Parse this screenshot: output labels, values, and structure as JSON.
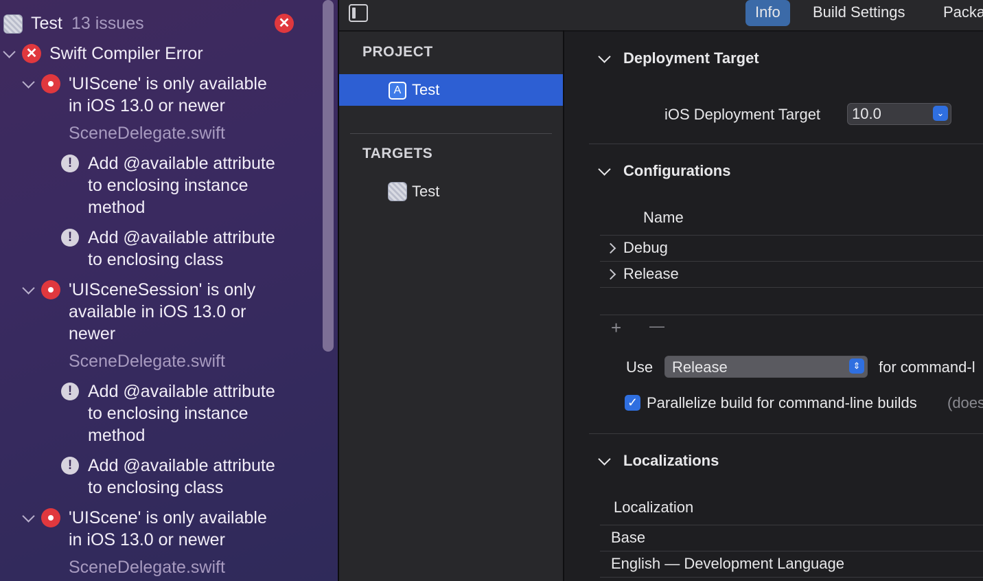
{
  "issues": {
    "header_title": "Test",
    "header_count": "13 issues",
    "group_title": "Swift Compiler Error",
    "items": [
      {
        "line1": "'UIScene' is only available",
        "line2": "in iOS 13.0 or newer",
        "file": "SceneDelegate.swift"
      },
      {
        "line1": "'UISceneSession' is only",
        "line2": "available in iOS 13.0 or",
        "line3": "newer",
        "file": "SceneDelegate.swift"
      },
      {
        "line1": "'UIScene' is only available",
        "line2": "in iOS 13.0 or newer",
        "file": "SceneDelegate.swift"
      }
    ],
    "fixits": [
      {
        "line1": "Add @available attribute",
        "line2": "to enclosing instance",
        "line3": "method"
      },
      {
        "line1": "Add @available attribute",
        "line2": "to enclosing class"
      },
      {
        "line1": "Add @available attribute",
        "line2": "to enclosing instance",
        "line3": "method"
      },
      {
        "line1": "Add @available attribute",
        "line2": "to enclosing class"
      }
    ]
  },
  "project_nav": {
    "project_header": "PROJECT",
    "project_item": "Test",
    "targets_header": "TARGETS",
    "target_item": "Test"
  },
  "tabs": {
    "info": "Info",
    "build_settings": "Build Settings",
    "packages": "Packa"
  },
  "deployment": {
    "title": "Deployment Target",
    "ios_label": "iOS Deployment Target",
    "ios_value": "10.0"
  },
  "configurations": {
    "title": "Configurations",
    "column_name": "Name",
    "rows": [
      "Debug",
      "Release"
    ],
    "add": "+",
    "remove": "—",
    "use_label": "Use",
    "use_value": "Release",
    "for_label": "for command-l",
    "parallelize_label": "Parallelize build for command-line builds",
    "parallelize_note": "(does",
    "parallelize_checked": true
  },
  "localizations": {
    "title": "Localizations",
    "column": "Localization",
    "rows": [
      "Base",
      "English — Development Language"
    ]
  }
}
